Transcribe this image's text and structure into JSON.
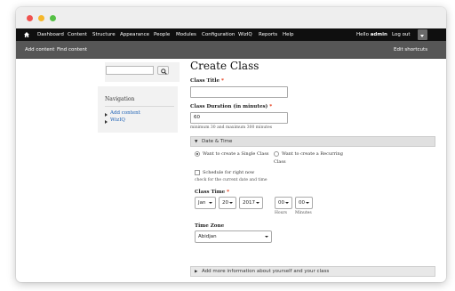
{
  "toolbar": {
    "items": [
      "Dashboard",
      "Content",
      "Structure",
      "Appearance",
      "People",
      "Modules",
      "Configuration",
      "WizIQ",
      "Reports",
      "Help"
    ],
    "hello_prefix": "Hello",
    "username": "admin",
    "logout": "Log out"
  },
  "shortcuts": {
    "add_content": "Add content",
    "find_content": "Find content",
    "edit_shortcuts": "Edit shortcuts"
  },
  "sidebar": {
    "search_placeholder": "",
    "navigation_title": "Navigation",
    "links": [
      "Add content",
      "WizIQ"
    ]
  },
  "main": {
    "title": "Create Class",
    "class_title_label": "Class Title",
    "class_title_value": "",
    "duration_label": "Class Duration (in minutes)",
    "duration_value": "60",
    "duration_hint": "minimum 30 and maximum 300 minutes",
    "date_time_section": "Date & Time",
    "radio_single": "Want to create a Single Class",
    "radio_recurring_line1": "Want to create a Recurring",
    "radio_recurring_line2": "Class",
    "schedule_line1": "Schedule for right now",
    "schedule_line2": "check for the current date and time",
    "class_time_label": "Class Time",
    "month": "Jan",
    "day": "20",
    "year": "2017",
    "hours": "00",
    "minutes": "00",
    "hours_label": "Hours",
    "minutes_label": "Minutes",
    "timezone_label": "Time Zone",
    "timezone_value": "Abidjan",
    "more_info_section": "Add more information about yourself and your class",
    "required_mark": "*"
  },
  "colors": {
    "toolbar_bg": "#0f0f0f",
    "shortcut_bg": "#565656",
    "link": "#1a5fb4",
    "required": "#e32700"
  }
}
